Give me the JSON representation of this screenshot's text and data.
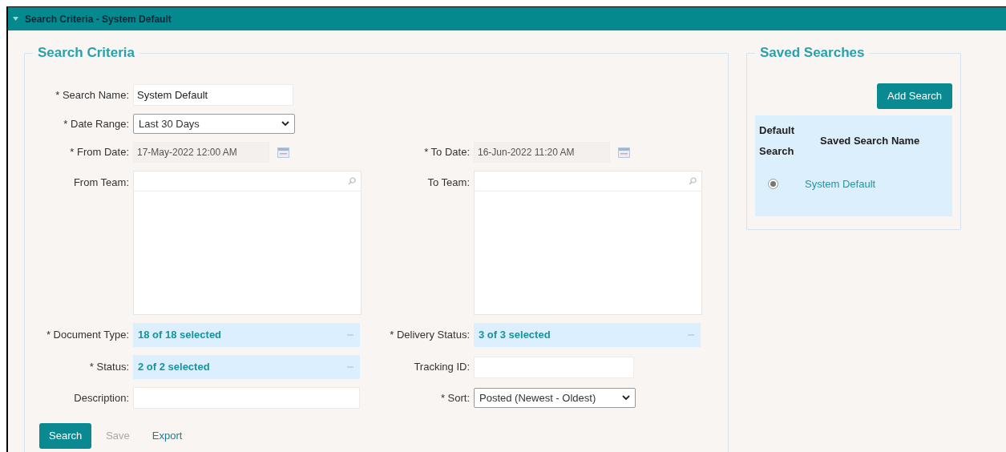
{
  "header": {
    "title": "Search Criteria - System Default",
    "expanded": true
  },
  "criteria": {
    "legend": "Search Criteria",
    "search_name": {
      "label": "* Search Name:",
      "value": "System Default"
    },
    "date_range": {
      "label": "* Date Range:",
      "value": "Last 30 Days"
    },
    "from_date": {
      "label": "* From Date:",
      "value": "17-May-2022 12:00 AM"
    },
    "to_date": {
      "label": "* To Date:",
      "value": "16-Jun-2022 11:20 AM"
    },
    "from_team": {
      "label": "From Team:"
    },
    "to_team": {
      "label": "To Team:"
    },
    "document_type": {
      "label": "* Document Type:",
      "value": "18 of 18 selected"
    },
    "delivery_status": {
      "label": "* Delivery Status:",
      "value": "3 of 3 selected"
    },
    "status": {
      "label": "* Status:",
      "value": "2 of 2 selected"
    },
    "tracking_id": {
      "label": "Tracking ID:"
    },
    "description": {
      "label": "Description:"
    },
    "sort": {
      "label": "* Sort:",
      "value": "Posted (Newest - Oldest)"
    },
    "buttons": [
      {
        "label": "Search",
        "kind": "primary",
        "disabled": false
      },
      {
        "label": "Save",
        "kind": "plain",
        "disabled": true
      },
      {
        "label": "Export",
        "kind": "plain",
        "disabled": false
      }
    ]
  },
  "saved": {
    "legend": "Saved Searches",
    "add_button": "Add Search",
    "columns": [
      "Default Search",
      "Saved Search Name"
    ],
    "rows": [
      {
        "name": "System Default",
        "selected": true
      }
    ]
  }
}
